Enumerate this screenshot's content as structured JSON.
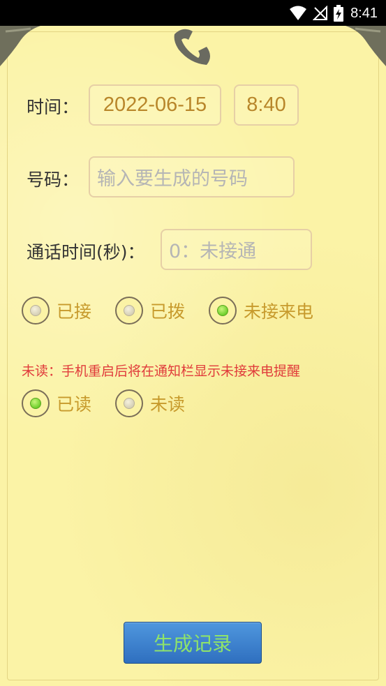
{
  "status_bar": {
    "time": "8:41",
    "icons": [
      "wifi-icon",
      "no-signal-icon",
      "battery-charging-icon"
    ]
  },
  "header": {
    "icon": "phone-handset-icon"
  },
  "form": {
    "time_label": "时间：",
    "date_value": "2022-06-15",
    "time_value": "8:40",
    "number_label": "号码：",
    "number_placeholder": "输入要生成的号码",
    "duration_label": "通话时间(秒)：",
    "duration_placeholder": "0：未接通",
    "call_types": [
      {
        "label": "已接",
        "checked": false
      },
      {
        "label": "已拨",
        "checked": false
      },
      {
        "label": "未接来电",
        "checked": true
      }
    ],
    "unread_note": "未读：手机重启后将在通知栏显示未接来电提醒",
    "read_states": [
      {
        "label": "已读",
        "checked": true
      },
      {
        "label": "未读",
        "checked": false
      }
    ],
    "generate_button": "生成记录"
  },
  "colors": {
    "paper": "#fbf3a6",
    "value_text": "#b8862a",
    "note_text": "#e03b3b",
    "button": "#3a7fcf",
    "button_text": "#8fe36a",
    "radio_checked": "#6fcf2c"
  }
}
